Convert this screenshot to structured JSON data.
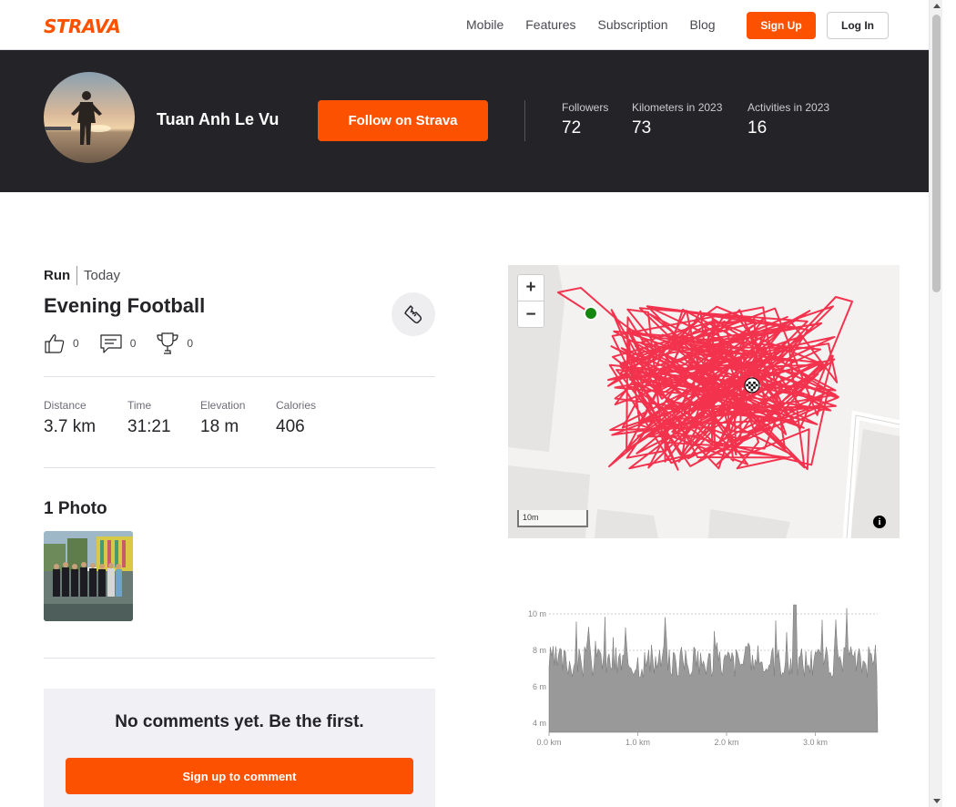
{
  "nav": {
    "logo": "STRAVA",
    "links": [
      "Mobile",
      "Features",
      "Subscription",
      "Blog"
    ],
    "signup": "Sign Up",
    "login": "Log In"
  },
  "athlete": {
    "name": "Tuan Anh Le Vu",
    "follow": "Follow on Strava",
    "stats": [
      {
        "label": "Followers",
        "value": "72"
      },
      {
        "label": "Kilometers in 2023",
        "value": "73"
      },
      {
        "label": "Activities in 2023",
        "value": "16"
      }
    ]
  },
  "activity": {
    "type": "Run",
    "date": "Today",
    "title": "Evening Football",
    "kudos": "0",
    "comments": "0",
    "achievements": "0",
    "metrics": [
      {
        "label": "Distance",
        "value": "3.7 km"
      },
      {
        "label": "Time",
        "value": "31:21"
      },
      {
        "label": "Elevation",
        "value": "18 m"
      },
      {
        "label": "Calories",
        "value": "406"
      }
    ],
    "photos_title": "1 Photo"
  },
  "comments": {
    "empty": "No comments yet. Be the first.",
    "signup": "Sign up to comment"
  },
  "map": {
    "zoom_in": "+",
    "zoom_out": "−",
    "scale": "10m",
    "info": "i",
    "route_color": "#f3334e"
  },
  "elevation": {
    "y_ticks": [
      "10 m",
      "8 m",
      "6 m",
      "4 m"
    ],
    "x_ticks": [
      "0.0 km",
      "1.0 km",
      "2.0 km",
      "3.0 km"
    ]
  },
  "colors": {
    "brand": "#fc5200",
    "dark": "#242428"
  }
}
